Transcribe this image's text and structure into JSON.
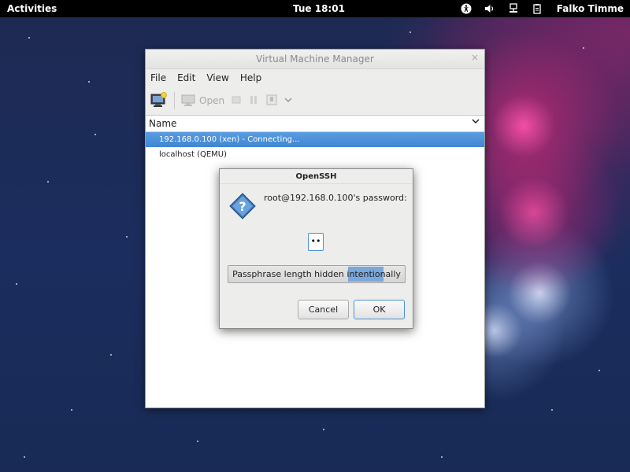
{
  "topbar": {
    "activities": "Activities",
    "clock": "Tue 18:01",
    "user": "Falko Timme",
    "tray_icons": [
      "accessibility-icon",
      "volume-icon",
      "network-icon",
      "clipboard-icon"
    ]
  },
  "vmm": {
    "title": "Virtual Machine Manager",
    "close": "×",
    "menu": [
      "File",
      "Edit",
      "View",
      "Help"
    ],
    "toolbar": {
      "open_label": "Open"
    },
    "column": "Name",
    "rows": [
      "192.168.0.100 (xen) - Connecting...",
      "localhost (QEMU)"
    ]
  },
  "dialog": {
    "title": "OpenSSH",
    "prompt": "root@192.168.0.100's password:",
    "password_value": "••",
    "bar_text": "Passphrase length hidden intentionally",
    "cancel": "Cancel",
    "ok": "OK"
  },
  "colors": {
    "selection": "#4a90d9",
    "topbar": "#000000",
    "desktop": "#1e2a52"
  }
}
